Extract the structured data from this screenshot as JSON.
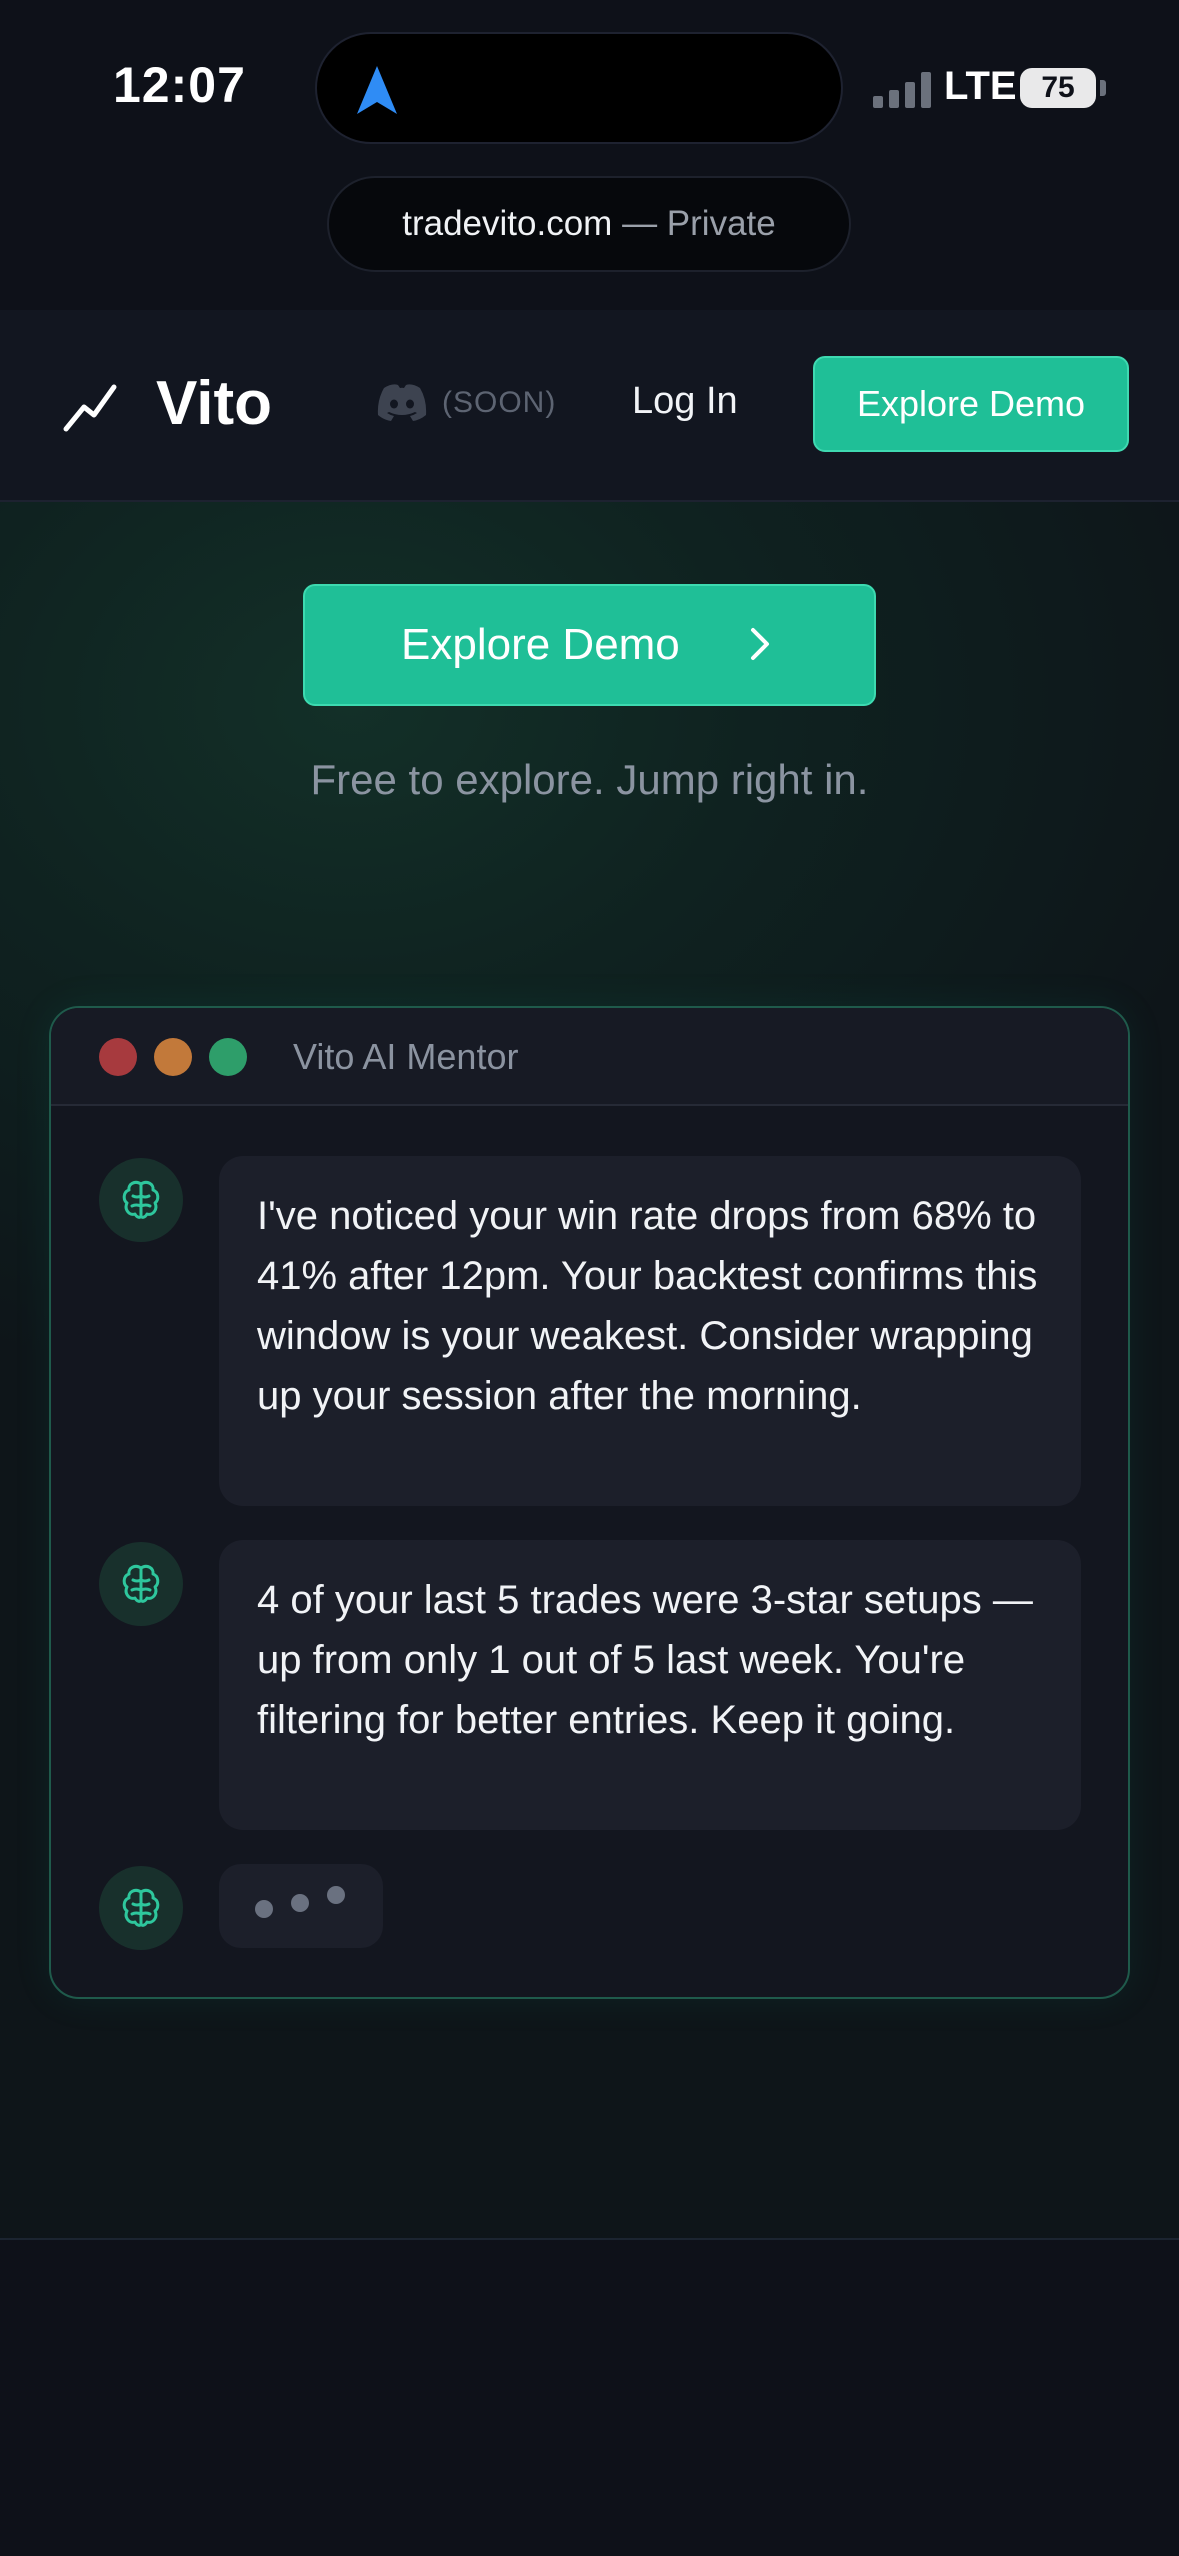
{
  "status_bar": {
    "time": "12:07",
    "network": "LTE",
    "battery": "75"
  },
  "browser": {
    "url_host": "tradevito.com",
    "url_suffix": " — Private"
  },
  "header": {
    "brand": "Vito",
    "discord_badge": "(SOON)",
    "login_label": "Log In",
    "cta_label": "Explore Demo"
  },
  "hero": {
    "cta_label": "Explore Demo",
    "tagline": "Free to explore. Jump right in."
  },
  "mentor_window": {
    "title": "Vito AI Mentor",
    "messages": [
      {
        "text": "I've noticed your win rate drops from 68% to 41% after 12pm. Your backtest confirms this window is your weakest. Consider wrapping up your session after the morning."
      },
      {
        "text": "4 of your last 5 trades were 3-star setups — up from only 1 out of 5 last week. You're filtering for better entries. Keep it going."
      }
    ]
  },
  "colors": {
    "accent": "#1fbf97",
    "background": "#0e1119",
    "bubble": "#1c1f2a"
  },
  "icons": [
    "navigation-arrow-icon",
    "signal-icon",
    "battery-icon",
    "trend-line-icon",
    "discord-icon",
    "chevron-right-icon",
    "brain-icon"
  ]
}
